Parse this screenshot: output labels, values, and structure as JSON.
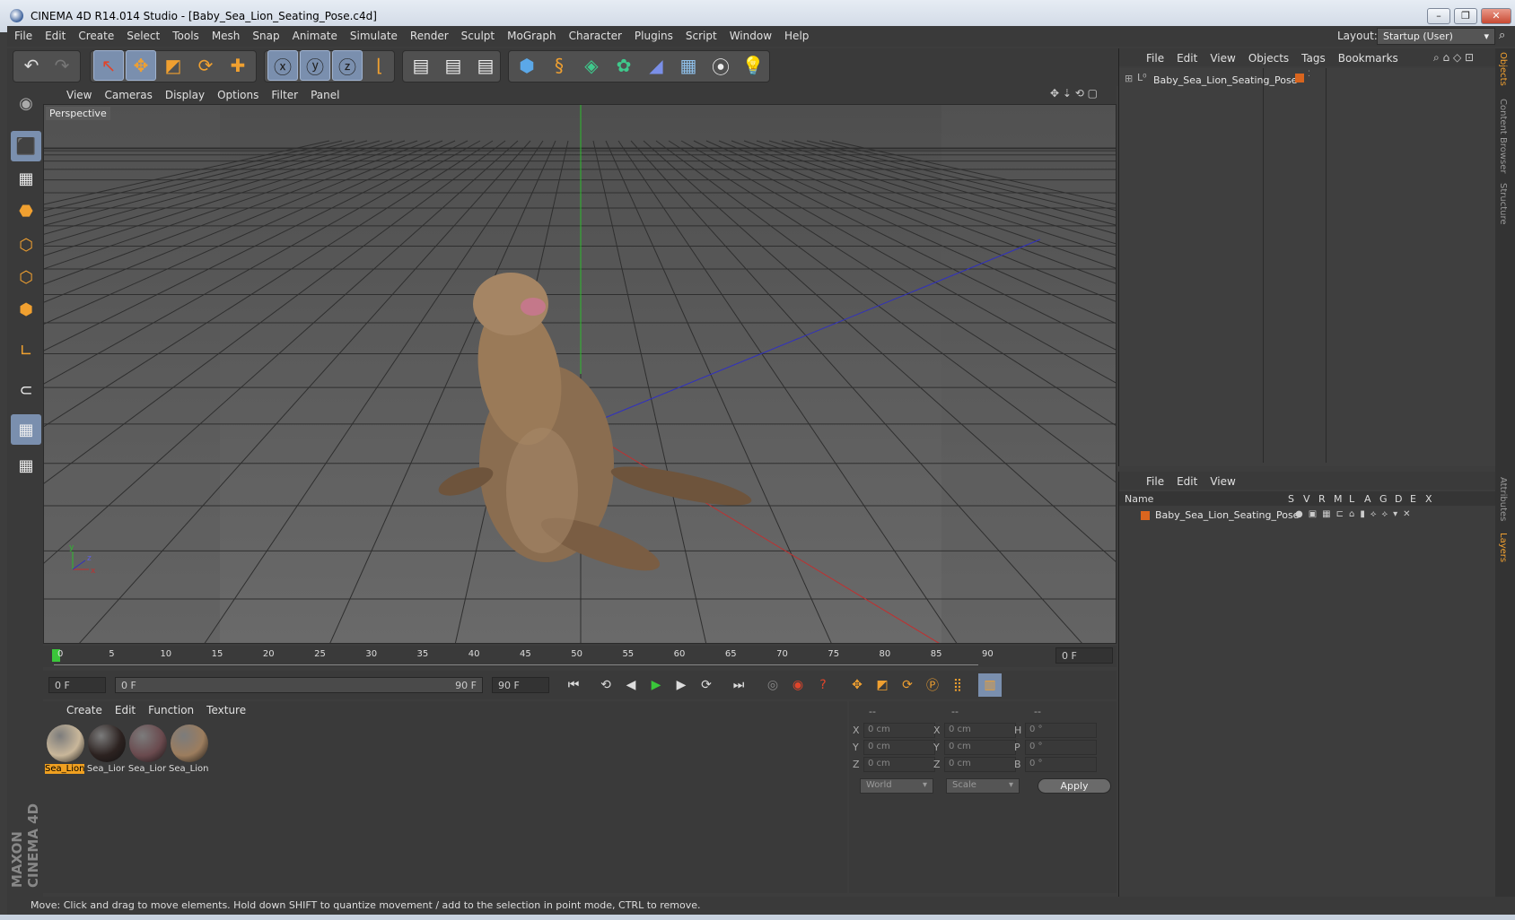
{
  "window": {
    "title": "CINEMA 4D R14.014 Studio - [Baby_Sea_Lion_Seating_Pose.c4d]"
  },
  "menu": {
    "items": [
      "File",
      "Edit",
      "Create",
      "Select",
      "Tools",
      "Mesh",
      "Snap",
      "Animate",
      "Simulate",
      "Render",
      "Sculpt",
      "MoGraph",
      "Character",
      "Plugins",
      "Script",
      "Window",
      "Help"
    ]
  },
  "layout": {
    "label": "Layout:",
    "value": "Startup (User)"
  },
  "viewport": {
    "menu": [
      "View",
      "Cameras",
      "Display",
      "Options",
      "Filter",
      "Panel"
    ],
    "label": "Perspective",
    "axes": {
      "x": "x",
      "y": "y",
      "z": "z"
    }
  },
  "timeline": {
    "ticks": [
      "0",
      "5",
      "10",
      "15",
      "20",
      "25",
      "30",
      "35",
      "40",
      "45",
      "50",
      "55",
      "60",
      "65",
      "70",
      "75",
      "80",
      "85",
      "90"
    ],
    "current_frame": "0 F"
  },
  "transport": {
    "start": "0 F",
    "range_start": "0 F",
    "range_end": "90 F",
    "end": "90 F"
  },
  "materials": {
    "menu": [
      "Create",
      "Edit",
      "Function",
      "Texture"
    ],
    "items": [
      "Sea_Lion",
      "Sea_Lior",
      "Sea_Lior",
      "Sea_Lion"
    ],
    "colors": [
      "#c9b79a",
      "#2c2220",
      "#6a4a4e",
      "#9c7d5e"
    ]
  },
  "coords": {
    "headers": [
      "--",
      "--",
      "--"
    ],
    "rows": [
      {
        "a": "X",
        "av": "0 cm",
        "b": "X",
        "bv": "0 cm",
        "c": "H",
        "cv": "0 °"
      },
      {
        "a": "Y",
        "av": "0 cm",
        "b": "Y",
        "bv": "0 cm",
        "c": "P",
        "cv": "0 °"
      },
      {
        "a": "Z",
        "av": "0 cm",
        "b": "Z",
        "bv": "0 cm",
        "c": "B",
        "cv": "0 °"
      }
    ],
    "space": "World",
    "mode": "Scale",
    "apply": "Apply"
  },
  "status": "Move: Click and drag to move elements. Hold down SHIFT to quantize movement / add to the selection in point mode, CTRL to remove.",
  "object_manager": {
    "menu": [
      "File",
      "Edit",
      "View",
      "Objects",
      "Tags",
      "Bookmarks"
    ],
    "object": "Baby_Sea_Lion_Seating_Pose"
  },
  "layer_manager": {
    "menu": [
      "File",
      "Edit",
      "View"
    ],
    "columns": [
      "Name",
      "S",
      "V",
      "R",
      "M",
      "L",
      "A",
      "G",
      "D",
      "E",
      "X"
    ],
    "layer": "Baby_Sea_Lion_Seating_Pose",
    "layer_color": "#d9651e"
  },
  "side_tabs": [
    "Objects",
    "Content Browser",
    "Structure",
    "Attributes",
    "Layers"
  ],
  "brand": "MAXON CINEMA 4D",
  "accent": "#f0a030"
}
